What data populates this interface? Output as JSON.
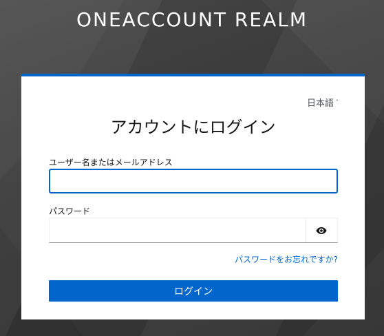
{
  "header": {
    "realm_title": "ONEACCOUNT REALM"
  },
  "login_card": {
    "language": "日本語",
    "title": "アカウントにログイン",
    "username": {
      "label": "ユーザー名またはメールアドレス",
      "value": "",
      "placeholder": ""
    },
    "password": {
      "label": "パスワード",
      "value": "",
      "placeholder": ""
    },
    "forgot_password_link": "パスワードをお忘れですか?",
    "login_button": "ログイン"
  },
  "icons": {
    "language_dropdown": "chevron-down-icon",
    "show_password": "eye-icon"
  },
  "colors": {
    "accent": "#0066cc",
    "background": "#3b3b3b",
    "card": "#ffffff"
  }
}
